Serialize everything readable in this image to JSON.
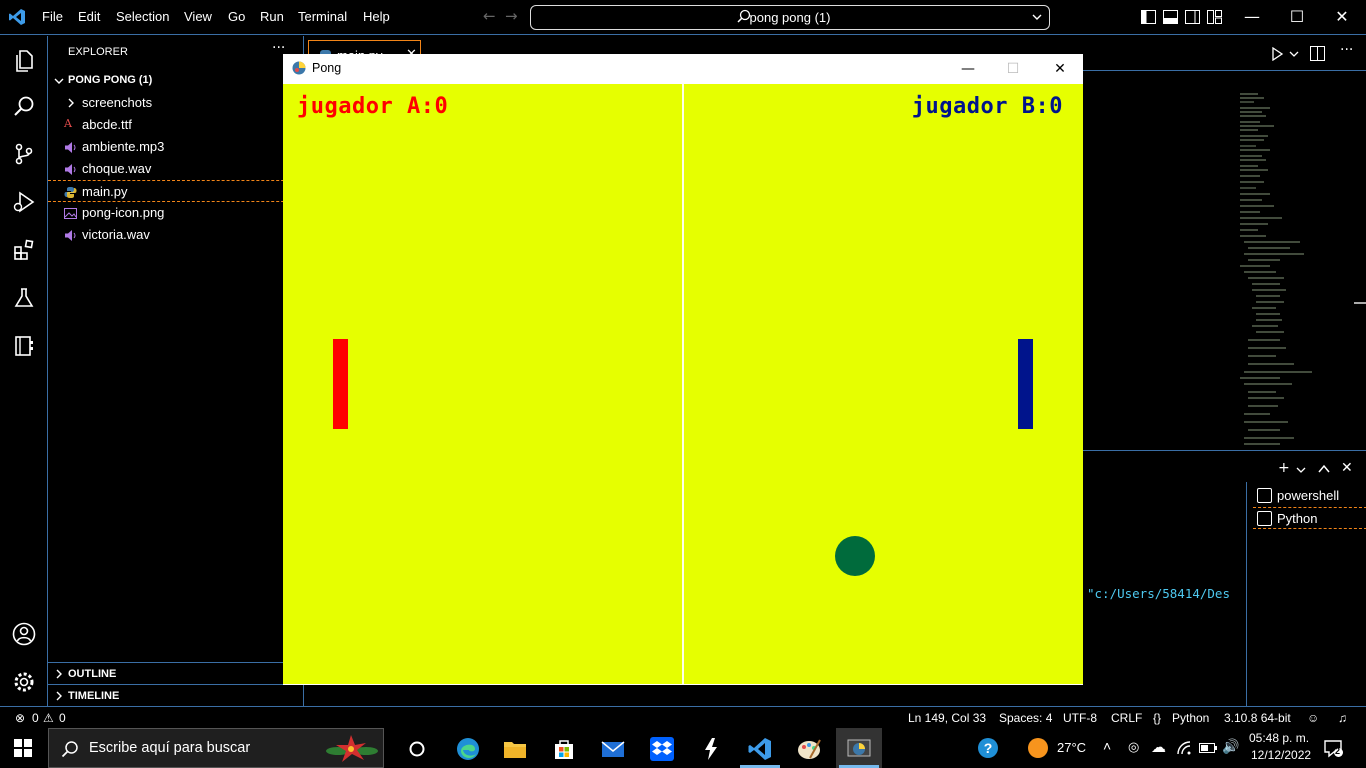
{
  "titlebar": {
    "menu": [
      "File",
      "Edit",
      "Selection",
      "View",
      "Go",
      "Run",
      "Terminal",
      "Help"
    ],
    "command_center": "pong pong (1)"
  },
  "sidebar": {
    "title": "EXPLORER",
    "more": "···",
    "folder": "PONG PONG (1)",
    "items": [
      {
        "label": "screenchots",
        "type": "folder"
      },
      {
        "label": "abcde.ttf",
        "type": "font"
      },
      {
        "label": "ambiente.mp3",
        "type": "audio"
      },
      {
        "label": "choque.wav",
        "type": "audio"
      },
      {
        "label": "main.py",
        "type": "python"
      },
      {
        "label": "pong-icon.png",
        "type": "image"
      },
      {
        "label": "victoria.wav",
        "type": "audio"
      }
    ],
    "outline": "OUTLINE",
    "timeline": "TIMELINE"
  },
  "editor": {
    "tab_label": "main.py"
  },
  "panel": {
    "terminal_path": "\"c:/Users/58414/Des",
    "terminals": [
      "powershell",
      "Python"
    ]
  },
  "pong": {
    "window_title": "Pong",
    "score_a": "jugador A:0",
    "score_b": "jugador B:0",
    "colors": {
      "background": "#e6ff00",
      "paddle_a": "#ff0000",
      "paddle_b": "#00148c",
      "ball": "#006b3c"
    }
  },
  "statusbar": {
    "errors": "0",
    "warnings": "0",
    "position": "Ln 149, Col 33",
    "spaces": "Spaces: 4",
    "encoding": "UTF-8",
    "eol": "CRLF",
    "language": "Python",
    "interpreter": "3.10.8 64-bit"
  },
  "taskbar": {
    "search_placeholder": "Escribe aquí para buscar",
    "temperature": "27°C",
    "time": "05:48 p. m.",
    "date": "12/12/2022",
    "notifications": "2"
  }
}
